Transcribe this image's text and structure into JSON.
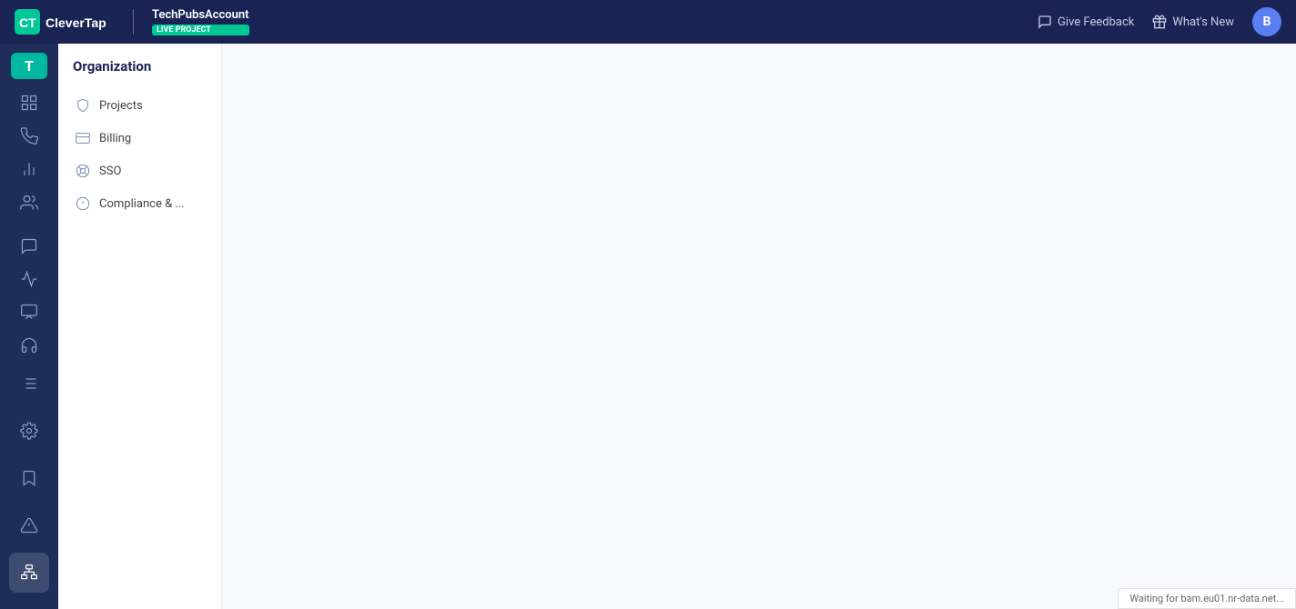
{
  "header": {
    "logo_text": "CleverTap",
    "logo_initial": "CT",
    "account_name": "TechPubsAccount",
    "live_badge": "LIVE PROJECT",
    "give_feedback_label": "Give Feedback",
    "whats_new_label": "What's New",
    "user_initial": "B"
  },
  "icon_sidebar": {
    "items": [
      {
        "name": "dashboard-icon",
        "icon": "grid",
        "active": false
      },
      {
        "name": "phone-icon",
        "icon": "phone",
        "active": false
      },
      {
        "name": "chart-icon",
        "icon": "chart",
        "active": false
      },
      {
        "name": "users-icon",
        "icon": "users",
        "active": false
      },
      {
        "name": "chat-icon",
        "icon": "chat",
        "active": false
      },
      {
        "name": "flow-icon",
        "icon": "flow",
        "active": false
      },
      {
        "name": "campaign-icon",
        "icon": "campaign",
        "active": false
      },
      {
        "name": "support-icon",
        "icon": "support",
        "active": false
      }
    ],
    "bottom_items": [
      {
        "name": "list-icon",
        "icon": "list"
      },
      {
        "name": "settings-icon",
        "icon": "settings"
      },
      {
        "name": "bookmark-icon",
        "icon": "bookmark"
      },
      {
        "name": "alert-icon",
        "icon": "alert"
      },
      {
        "name": "org-icon",
        "icon": "org",
        "active": true
      }
    ]
  },
  "org_sidebar": {
    "title": "Organization",
    "menu_items": [
      {
        "label": "Projects",
        "icon": "shield",
        "active": false
      },
      {
        "label": "Billing",
        "icon": "billing",
        "active": false
      },
      {
        "label": "SSO",
        "icon": "sso",
        "active": false
      },
      {
        "label": "Compliance & ...",
        "icon": "compliance",
        "active": false
      }
    ]
  },
  "status_bar": {
    "text": "Waiting for bam.eu01.nr-data.net..."
  }
}
